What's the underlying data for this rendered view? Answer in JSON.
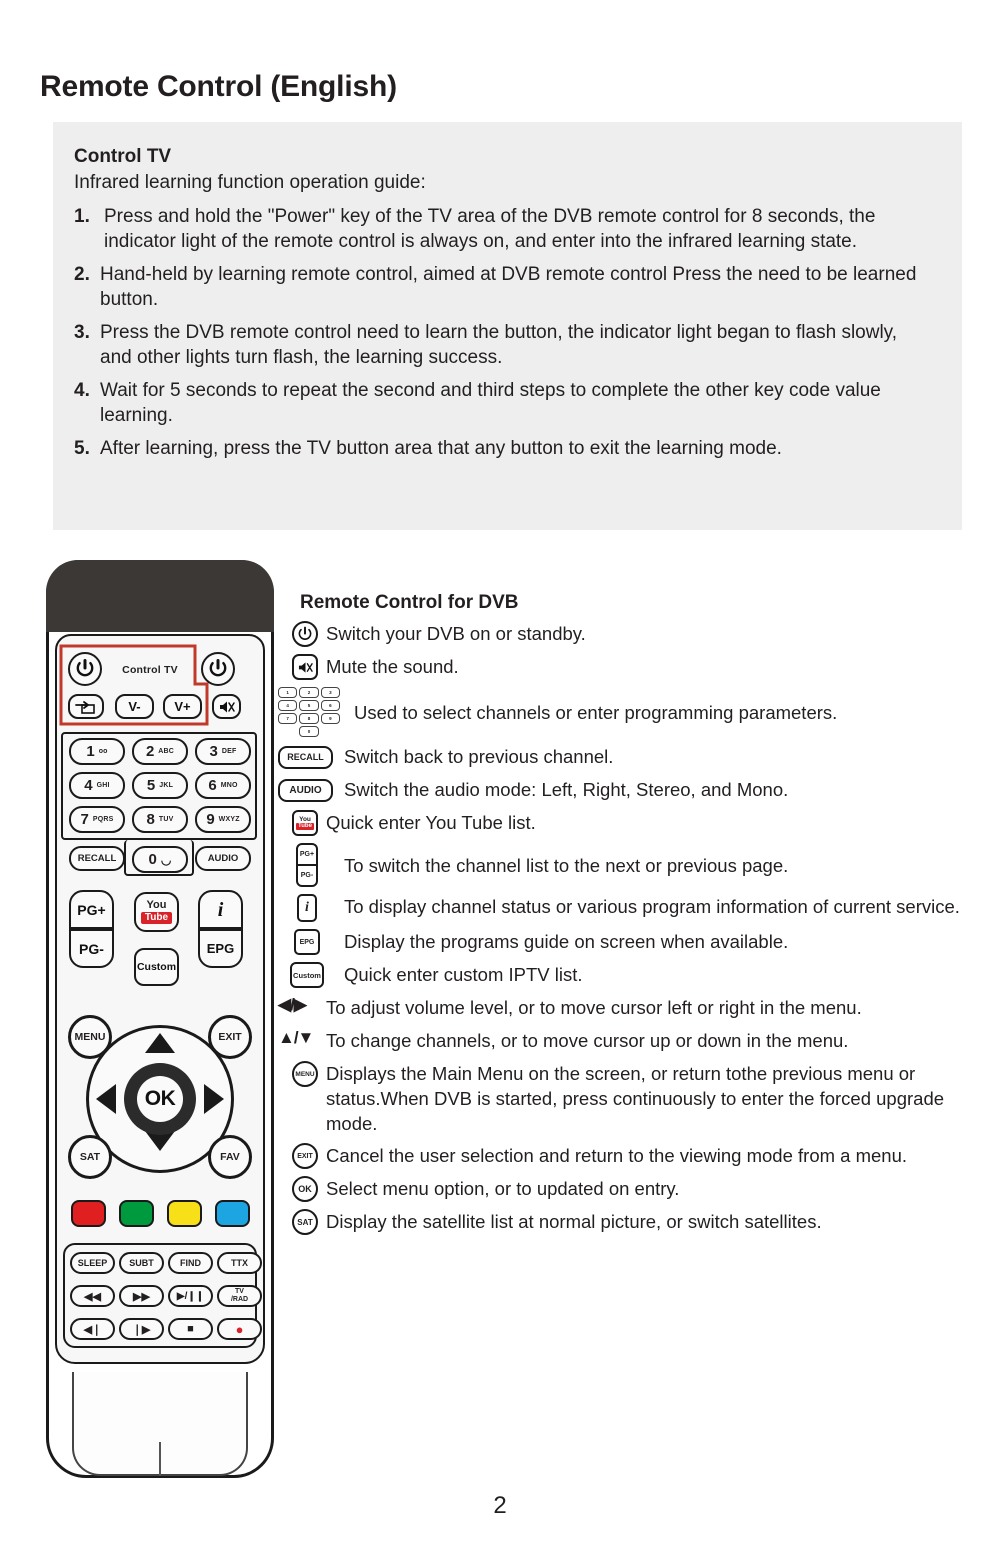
{
  "page": {
    "title": "Remote Control (English)",
    "number": "2"
  },
  "panel": {
    "heading": "Control TV",
    "subheading": "Infrared learning function operation guide:",
    "steps": [
      {
        "num": "1.",
        "text": "Press and hold the \"Power\" key of the TV area of the DVB remote control for 8 seconds, the indicator light of the remote control is always on, and enter into the infrared learning state."
      },
      {
        "num": "2.",
        "text": "Hand-held by learning remote control, aimed at DVB remote control Press the need to be learned button."
      },
      {
        "num": "3.",
        "text": "Press the DVB remote control need to learn the button, the indicator light began to flash slowly, and other lights turn flash, the learning success."
      },
      {
        "num": "4.",
        "text": "Wait for 5 seconds to repeat the second and third steps to complete the other key code value learning."
      },
      {
        "num": "5.",
        "text": "After learning, press the TV button area that any button to exit the learning mode."
      }
    ]
  },
  "remote": {
    "control_tv_label": "Control TV",
    "outline_color": "#c0392b",
    "keys": {
      "power_tv": "power-icon",
      "power_dvb": "power-icon",
      "source": "source-icon",
      "vol_down": "V-",
      "vol_up": "V+",
      "mute": "mute-icon",
      "numbers": [
        {
          "digit": "1",
          "sub": "oo"
        },
        {
          "digit": "2",
          "sub": "ABC"
        },
        {
          "digit": "3",
          "sub": "DEF"
        },
        {
          "digit": "4",
          "sub": "GHI"
        },
        {
          "digit": "5",
          "sub": "JKL"
        },
        {
          "digit": "6",
          "sub": "MNO"
        },
        {
          "digit": "7",
          "sub": "PQRS"
        },
        {
          "digit": "8",
          "sub": "TUV"
        },
        {
          "digit": "9",
          "sub": "WXYZ"
        }
      ],
      "recall": "RECALL",
      "zero": "0",
      "zero_sub": "space-icon",
      "audio": "AUDIO",
      "pg_up": "PG+",
      "pg_down": "PG-",
      "youtube_top": "You",
      "youtube_bottom": "Tube",
      "custom": "Custom",
      "info": "i",
      "epg": "EPG",
      "menu": "MENU",
      "exit": "EXIT",
      "ok": "OK",
      "sat": "SAT",
      "fav": "FAV",
      "color_buttons": [
        "#e02020",
        "#009a3e",
        "#f7e017",
        "#1ca5e0"
      ],
      "media": [
        {
          "label": "SLEEP"
        },
        {
          "label": "SUBT"
        },
        {
          "label": "FIND"
        },
        {
          "label": "TTX"
        },
        {
          "label": "◀◀"
        },
        {
          "label": "▶▶"
        },
        {
          "label": "▶/❙❙"
        },
        {
          "label": "TV",
          "label2": "/RAD"
        },
        {
          "label": "◀❘"
        },
        {
          "label": "❘▶"
        },
        {
          "label": "■"
        },
        {
          "label": "●",
          "color": "#d8232a"
        }
      ]
    }
  },
  "legend": {
    "title": "Remote Control for DVB",
    "rows": [
      {
        "icon": "power-icon",
        "text": "Switch your DVB on or standby."
      },
      {
        "icon": "mute-icon",
        "text": "Mute the sound."
      },
      {
        "icon": "keypad-icon",
        "text": "Used to select channels or enter programming parameters."
      },
      {
        "icon": "recall-icon",
        "label": "RECALL",
        "text": "Switch back to previous channel."
      },
      {
        "icon": "audio-icon",
        "label": "AUDIO",
        "text": "Switch the audio mode: Left, Right, Stereo, and Mono."
      },
      {
        "icon": "youtube-icon",
        "text": "Quick enter You Tube list."
      },
      {
        "icon": "page-updown-icon",
        "label_top": "PG+",
        "label_bottom": "PG-",
        "text": "To switch the channel list to the next or previous page."
      },
      {
        "icon": "info-icon",
        "label": "i",
        "text": "To display channel status or various program information of current service."
      },
      {
        "icon": "epg-icon",
        "label": "EPG",
        "text": "Display the programs guide on screen when available."
      },
      {
        "icon": "custom-icon",
        "label": "Custom",
        "text": "Quick enter custom IPTV list."
      },
      {
        "icon": "left-right-arrow-icon",
        "label": "◀/▶",
        "text": "To adjust volume level, or to move cursor left or right in the menu."
      },
      {
        "icon": "up-down-arrow-icon",
        "label": "▲/▼",
        "text": "To change channels, or to move cursor up or down  in the menu."
      },
      {
        "icon": "menu-icon",
        "label": "MENU",
        "text": "Displays the Main Menu on the screen, or return tothe previous menu or status.When DVB is started, press continuously to enter the forced upgrade mode."
      },
      {
        "icon": "exit-icon",
        "label": "EXIT",
        "text": "Cancel the user selection and return to the viewing mode from  a menu."
      },
      {
        "icon": "ok-icon",
        "label": "OK",
        "text": "Select menu option, or to updated on entry."
      },
      {
        "icon": "sat-icon",
        "label": "SAT",
        "text": "Display the satellite list at normal picture, or switch satellites."
      }
    ],
    "keypad_icon_keys": [
      "1",
      "2",
      "3",
      "4",
      "5",
      "6",
      "7",
      "8",
      "9",
      "0"
    ]
  }
}
